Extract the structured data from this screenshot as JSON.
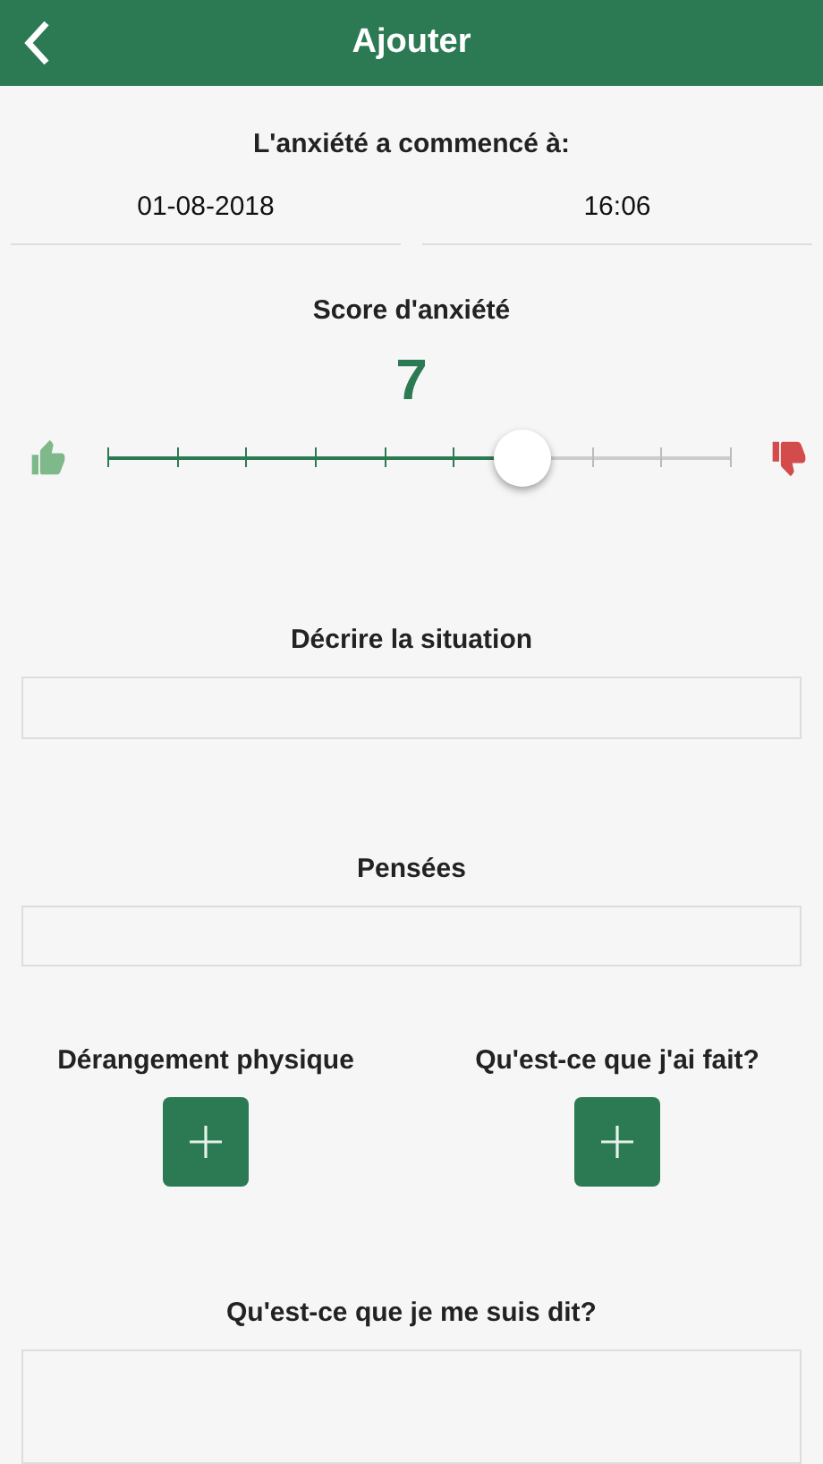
{
  "header": {
    "title": "Ajouter"
  },
  "start": {
    "label": "L'anxiété a commencé à:",
    "date": "01-08-2018",
    "time": "16:06"
  },
  "score": {
    "label": "Score d'anxiété",
    "value": "7",
    "level": 0.667
  },
  "fields": [
    {
      "label": "Décrire la situation"
    },
    {
      "label": "Pensées"
    }
  ],
  "adders": [
    {
      "label": "Dérangement physique"
    },
    {
      "label": "Qu'est-ce que j'ai fait?"
    }
  ],
  "last_field": {
    "label": "Qu'est-ce que je me suis dit?"
  }
}
